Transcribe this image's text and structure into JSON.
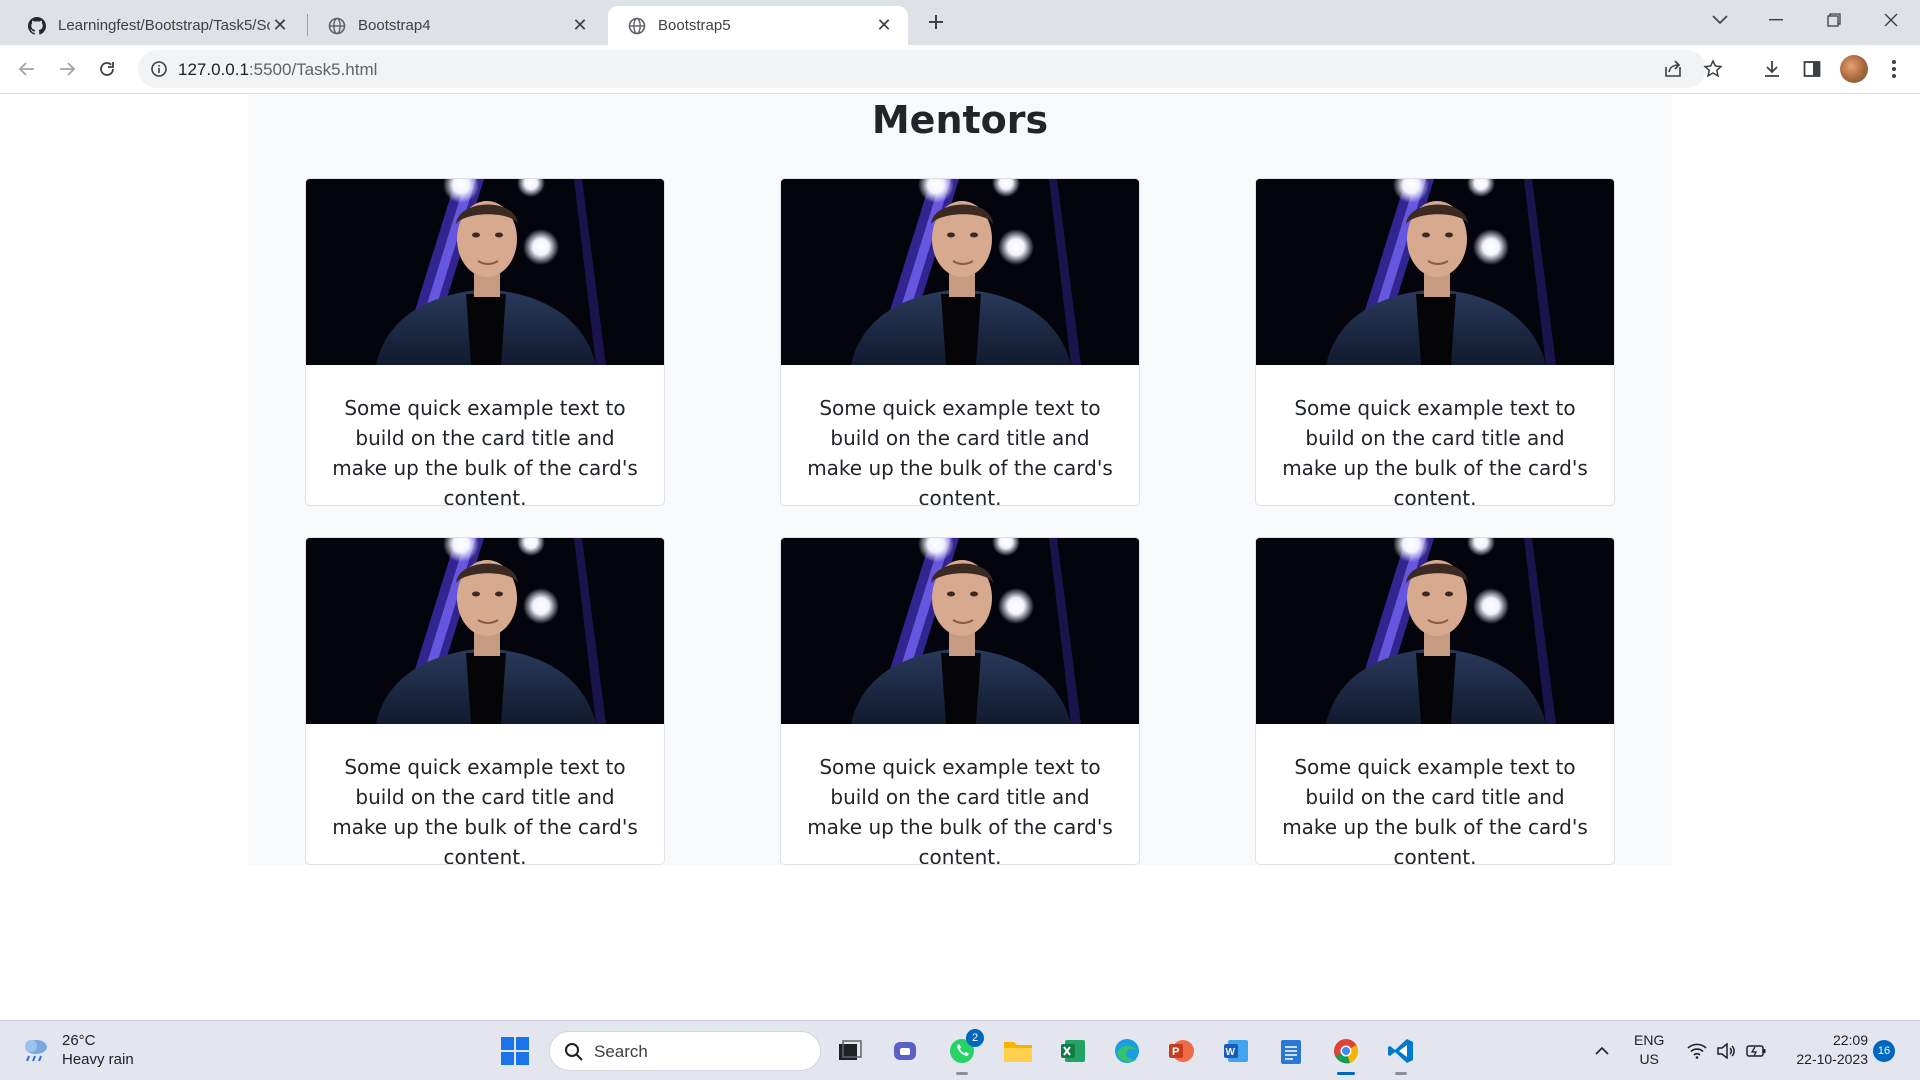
{
  "browser": {
    "tabs": [
      {
        "title": "Learningfest/Bootstrap/Task5/Sc",
        "favicon": "github-icon",
        "active": false
      },
      {
        "title": "Bootstrap4",
        "favicon": "globe-icon",
        "active": false
      },
      {
        "title": "Bootstrap5",
        "favicon": "globe-icon",
        "active": true
      }
    ],
    "url_host": "127.0.0.1",
    "url_path": ":5500/Task5.html"
  },
  "page": {
    "heading": "Mentors",
    "cards": [
      {
        "text": "Some quick example text to build on the card title and make up the bulk of the card's content."
      },
      {
        "text": "Some quick example text to build on the card title and make up the bulk of the card's content."
      },
      {
        "text": "Some quick example text to build on the card title and make up the bulk of the card's content."
      },
      {
        "text": "Some quick example text to build on the card title and make up the bulk of the card's content."
      },
      {
        "text": "Some quick example text to build on the card title and make up the bulk of the card's content."
      },
      {
        "text": "Some quick example text to build on the card title and make up the bulk of the card's content."
      }
    ]
  },
  "taskbar": {
    "weather_temp": "26°C",
    "weather_desc": "Heavy rain",
    "search_label": "Search",
    "whatsapp_badge": "2",
    "lang_top": "ENG",
    "lang_bottom": "US",
    "time": "22:09",
    "date": "22-10-2023",
    "notification_count": "16"
  },
  "colors": {
    "accent": "#0067c0",
    "container_bg": "#f8f9fa",
    "tabstrip_bg": "#dee1e6"
  }
}
